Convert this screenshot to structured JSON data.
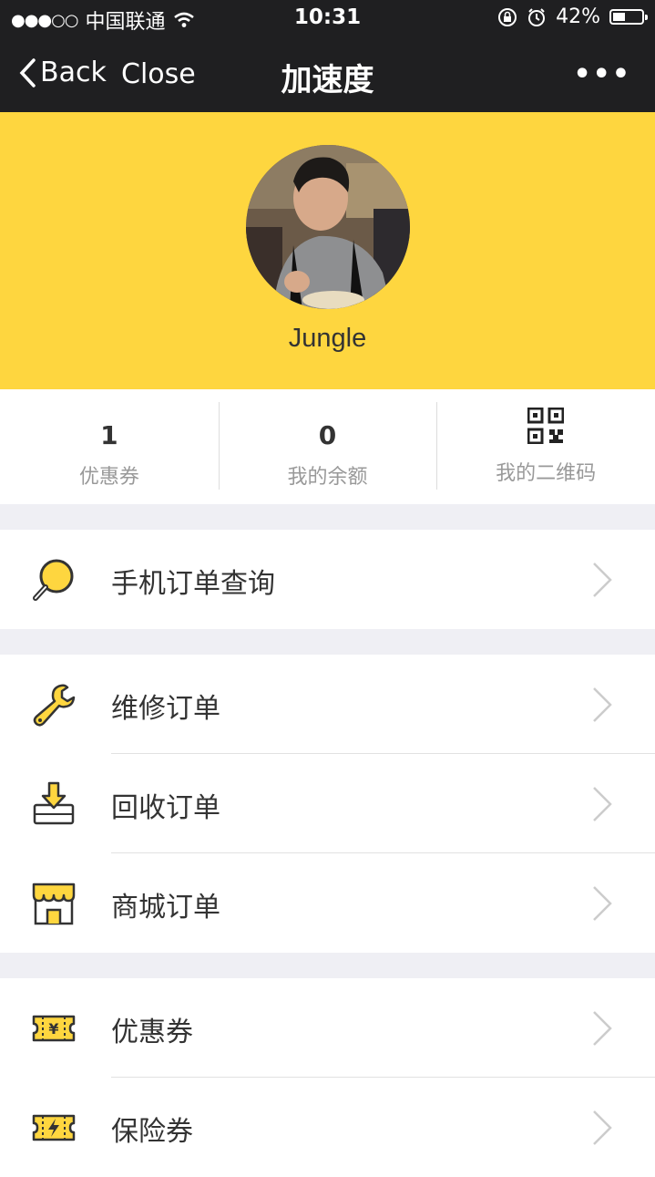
{
  "status": {
    "carrier": "中国联通",
    "time": "10:31",
    "battery": "42%",
    "battery_level": 0.42
  },
  "nav": {
    "back": "Back",
    "close": "Close",
    "title": "加速度",
    "more": "•••"
  },
  "profile": {
    "username": "Jungle"
  },
  "stats": [
    {
      "value": "1",
      "label": "优惠券"
    },
    {
      "value": "0",
      "label": "我的余额"
    },
    {
      "label": "我的二维码",
      "icon": "qr-code-icon"
    }
  ],
  "menu": {
    "query": {
      "label": "手机订单查询",
      "icon": "magnifier-icon"
    },
    "repair": {
      "label": "维修订单",
      "icon": "wrench-icon"
    },
    "recycle": {
      "label": "回收订单",
      "icon": "download-tray-icon"
    },
    "mall": {
      "label": "商城订单",
      "icon": "store-icon"
    },
    "coupon": {
      "label": "优惠券",
      "icon": "yen-ticket-icon"
    },
    "insurance": {
      "label": "保险券",
      "icon": "lightning-ticket-icon"
    }
  },
  "colors": {
    "accent": "#fed63f",
    "nav_bg": "#1f1f21",
    "icon_yellow": "#fed63f",
    "icon_stroke": "#333333"
  }
}
